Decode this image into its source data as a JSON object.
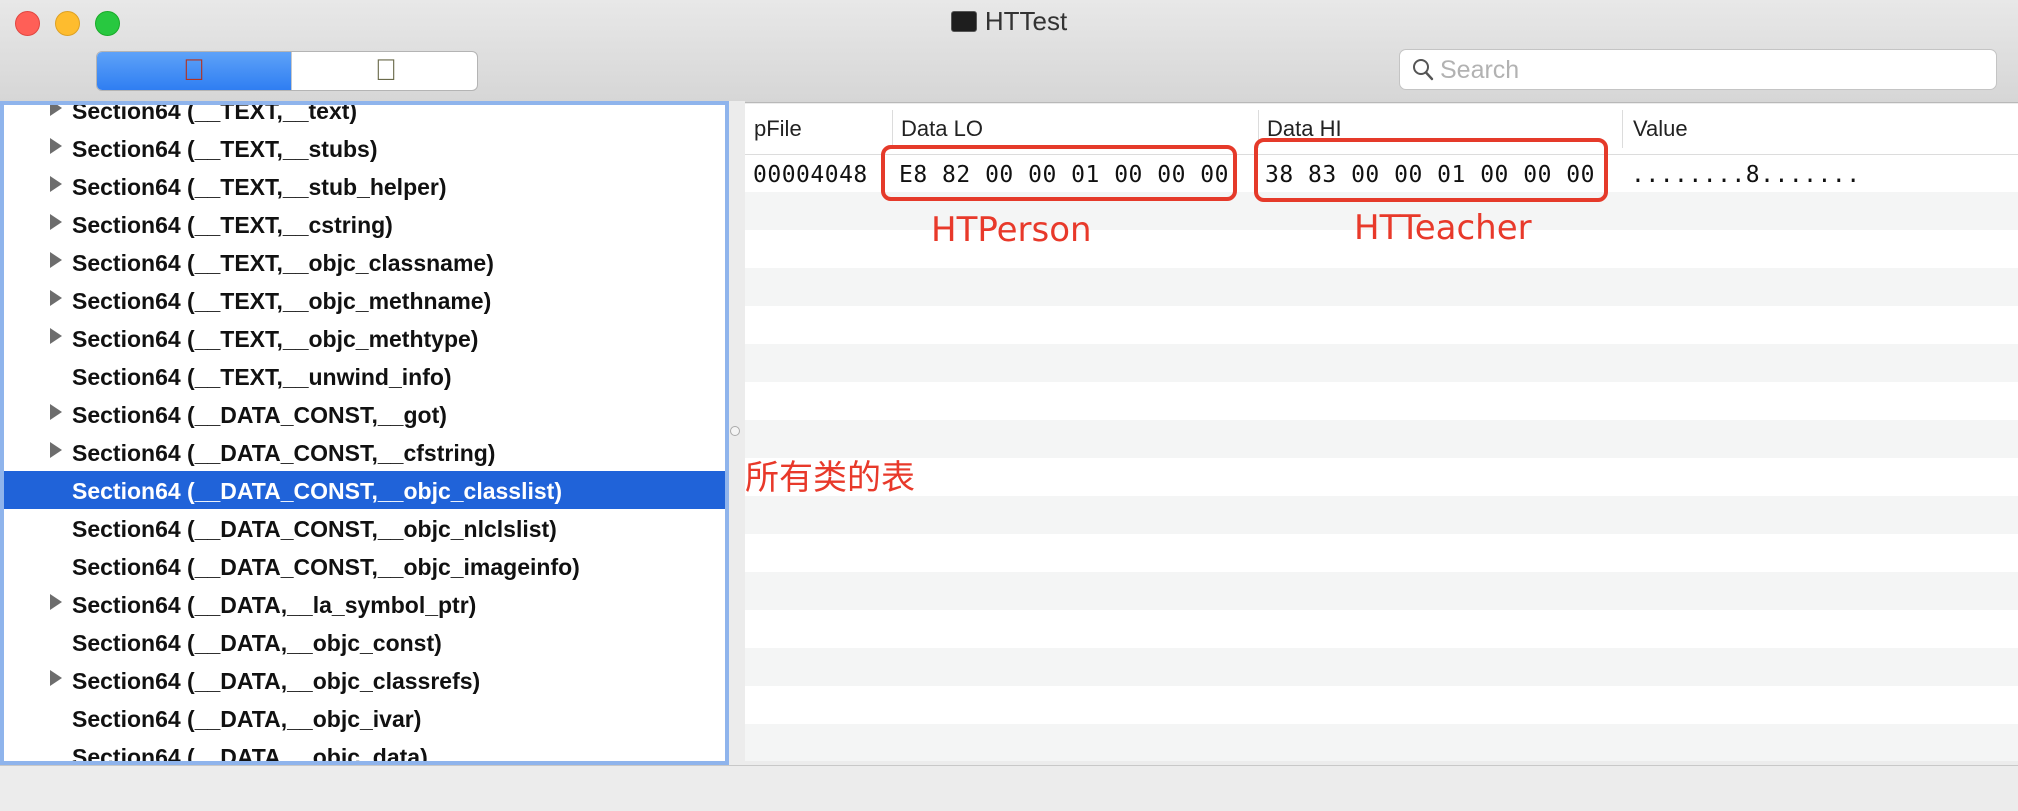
{
  "window": {
    "title": "HTTest",
    "colors": {
      "selection": "#2063d9",
      "annotation": "#e53a2a",
      "segment_active": "#3b86f5"
    }
  },
  "toolbar": {
    "segments": [
      {
        "icon": "red-apple-icon",
        "active": true
      },
      {
        "icon": "green-apple-icon",
        "active": false
      }
    ],
    "search": {
      "placeholder": "Search",
      "value": ""
    }
  },
  "outline": {
    "items": [
      {
        "label": "Section64 (__TEXT,__text)",
        "expandable": true,
        "selected": false
      },
      {
        "label": "Section64 (__TEXT,__stubs)",
        "expandable": true,
        "selected": false
      },
      {
        "label": "Section64 (__TEXT,__stub_helper)",
        "expandable": true,
        "selected": false
      },
      {
        "label": "Section64 (__TEXT,__cstring)",
        "expandable": true,
        "selected": false
      },
      {
        "label": "Section64 (__TEXT,__objc_classname)",
        "expandable": true,
        "selected": false
      },
      {
        "label": "Section64 (__TEXT,__objc_methname)",
        "expandable": true,
        "selected": false
      },
      {
        "label": "Section64 (__TEXT,__objc_methtype)",
        "expandable": true,
        "selected": false
      },
      {
        "label": "Section64 (__TEXT,__unwind_info)",
        "expandable": false,
        "selected": false
      },
      {
        "label": "Section64 (__DATA_CONST,__got)",
        "expandable": true,
        "selected": false
      },
      {
        "label": "Section64 (__DATA_CONST,__cfstring)",
        "expandable": true,
        "selected": false
      },
      {
        "label": "Section64 (__DATA_CONST,__objc_classlist)",
        "expandable": false,
        "selected": true
      },
      {
        "label": "Section64 (__DATA_CONST,__objc_nlclslist)",
        "expandable": false,
        "selected": false
      },
      {
        "label": "Section64 (__DATA_CONST,__objc_imageinfo)",
        "expandable": false,
        "selected": false
      },
      {
        "label": "Section64 (__DATA,__la_symbol_ptr)",
        "expandable": true,
        "selected": false
      },
      {
        "label": "Section64 (__DATA,__objc_const)",
        "expandable": false,
        "selected": false
      },
      {
        "label": "Section64 (__DATA,__objc_classrefs)",
        "expandable": true,
        "selected": false
      },
      {
        "label": "Section64 (__DATA,__objc_ivar)",
        "expandable": false,
        "selected": false
      },
      {
        "label": "Section64 (__DATA,__objc_data)",
        "expandable": false,
        "selected": false
      }
    ]
  },
  "table": {
    "columns": [
      "pFile",
      "Data LO",
      "Data HI",
      "Value"
    ],
    "rows": [
      {
        "pfile": "00004048",
        "data_lo": "E8 82 00 00 01 00 00 00",
        "data_hi": "38 83 00 00 01 00 00 00",
        "value": "........8......."
      }
    ]
  },
  "annotations": {
    "data_lo_note": "HTPerson",
    "data_hi_note": "HTTeacher",
    "class_table_note": "所有类的表"
  }
}
